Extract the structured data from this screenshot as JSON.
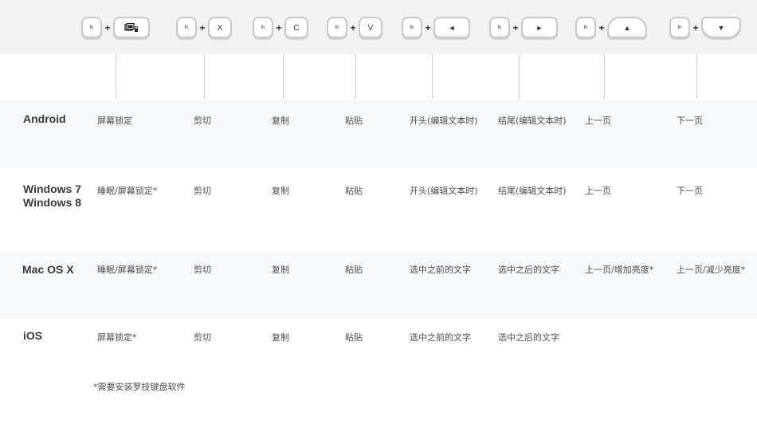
{
  "shortcut_keys": [
    {
      "fn": "fn",
      "plus": "+",
      "key_icon": "lock-screen-icon"
    },
    {
      "fn": "fn",
      "plus": "+",
      "key": "X"
    },
    {
      "fn": "fn",
      "plus": "+",
      "key": "C"
    },
    {
      "fn": "fn",
      "plus": "+",
      "key": "V"
    },
    {
      "fn": "fn",
      "plus": "+",
      "key": "◄"
    },
    {
      "fn": "fn",
      "plus": "+",
      "key": "►"
    },
    {
      "fn": "fn",
      "plus": "+",
      "key": "▲"
    },
    {
      "fn": "fn",
      "plus": "+",
      "key": "▼"
    }
  ],
  "rows": [
    {
      "os": [
        "Android"
      ],
      "cells": [
        "屏幕锁定",
        "剪切",
        "复制",
        "粘贴",
        "开头(编辑文本时)",
        "结尾(编辑文本时)",
        "上一页",
        "下一页"
      ]
    },
    {
      "os": [
        "Windows 7",
        "Windows 8"
      ],
      "cells": [
        "睡眠/屏幕锁定*",
        "剪切",
        "复制",
        "粘贴",
        "开头(编辑文本时)",
        "结尾(编辑文本时)",
        "上一页",
        "下一页"
      ]
    },
    {
      "os": [
        "Mac OS X"
      ],
      "cells": [
        "睡眠/屏幕锁定*",
        "剪切",
        "复制",
        "粘贴",
        "选中之前的文字",
        "选中之后的文字",
        "上一页/增加亮度*",
        "上一页/减少亮度*"
      ]
    },
    {
      "os": [
        "iOS"
      ],
      "cells": [
        "屏幕锁定*",
        "剪切",
        "复制",
        "粘贴",
        "选中之前的文字",
        "选中之后的文字",
        "",
        ""
      ]
    }
  ],
  "footnote": "*需要安装罗技键盘软件"
}
